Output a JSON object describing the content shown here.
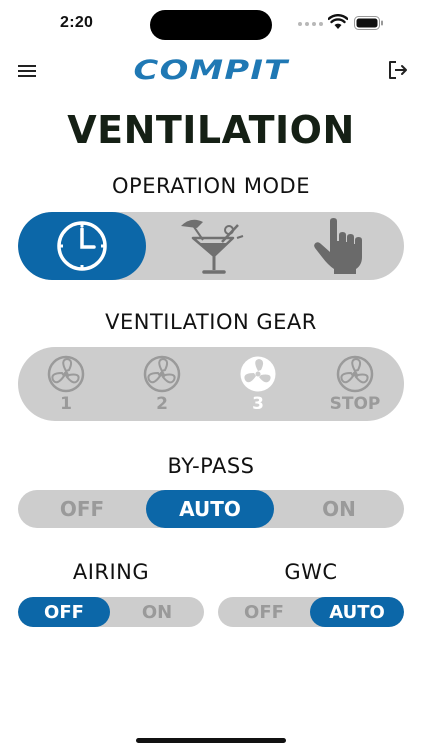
{
  "status_bar": {
    "time": "2:20"
  },
  "header": {
    "logo_text": "COMPIT"
  },
  "page": {
    "title": "VENTILATION"
  },
  "operation_mode": {
    "label": "OPERATION MODE",
    "options": [
      {
        "icon": "clock-icon",
        "active": true
      },
      {
        "icon": "cocktail-icon",
        "active": false
      },
      {
        "icon": "hand-pointer-icon",
        "active": false
      }
    ]
  },
  "ventilation_gear": {
    "label": "VENTILATION GEAR",
    "options": [
      {
        "label": "1",
        "icon": "fan-icon",
        "active": false
      },
      {
        "label": "2",
        "icon": "fan-icon",
        "active": false
      },
      {
        "label": "3",
        "icon": "fan-icon",
        "active": true
      },
      {
        "label": "STOP",
        "icon": "fan-icon",
        "active": false
      }
    ]
  },
  "by_pass": {
    "label": "BY-PASS",
    "options": [
      {
        "label": "OFF",
        "active": false
      },
      {
        "label": "AUTO",
        "active": true
      },
      {
        "label": "ON",
        "active": false
      }
    ]
  },
  "airing": {
    "label": "AIRING",
    "options": [
      {
        "label": "OFF",
        "active": true
      },
      {
        "label": "ON",
        "active": false
      }
    ]
  },
  "gwc": {
    "label": "GWC",
    "options": [
      {
        "label": "OFF",
        "active": false
      },
      {
        "label": "AUTO",
        "active": true
      }
    ]
  },
  "colors": {
    "accent": "#0c67a8",
    "logo": "#1f78b4",
    "pill_background": "#cdcdcd",
    "inactive_text": "#9a9a9a",
    "title": "#152015"
  }
}
